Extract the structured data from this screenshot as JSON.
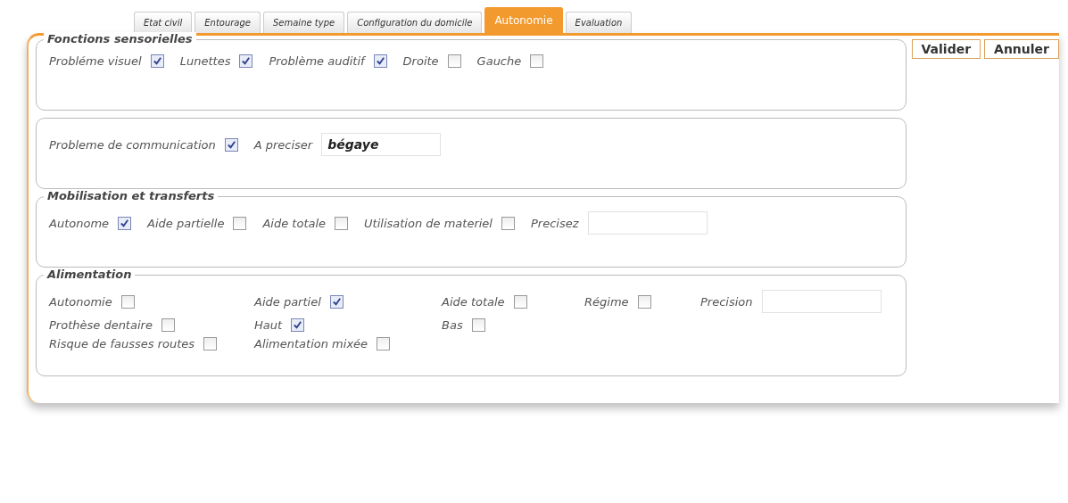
{
  "tabs": [
    {
      "label": "Etat civil",
      "selected": false
    },
    {
      "label": "Entourage",
      "selected": false
    },
    {
      "label": "Semaine type",
      "selected": false
    },
    {
      "label": "Configuration du domicile",
      "selected": false
    },
    {
      "label": "Autonomie",
      "selected": true
    },
    {
      "label": "Evaluation",
      "selected": false
    }
  ],
  "buttons": [
    "Valider",
    "Annuler"
  ],
  "sections": [
    {
      "legend": "Fonctions sensorielles",
      "rows": [
        [
          {
            "kind": "checkbox",
            "label": "Probléme visuel",
            "checked": true
          },
          {
            "kind": "checkbox",
            "label": "Lunettes",
            "checked": true
          },
          {
            "kind": "checkbox",
            "label": "Problème auditif",
            "checked": true
          },
          {
            "kind": "checkbox",
            "label": "Droite",
            "checked": false
          },
          {
            "kind": "checkbox",
            "label": "Gauche",
            "checked": false
          }
        ]
      ]
    },
    {
      "rows": [
        [
          {
            "kind": "checkbox",
            "label": "Probleme de communication",
            "checked": true
          },
          {
            "kind": "text",
            "label": "A preciser",
            "value": "bégaye"
          }
        ]
      ]
    },
    {
      "legend": "Mobilisation et transferts",
      "rows": [
        [
          {
            "kind": "checkbox",
            "label": "Autonome",
            "checked": true
          },
          {
            "kind": "checkbox",
            "label": "Aide partielle",
            "checked": false
          },
          {
            "kind": "checkbox",
            "label": "Aide totale",
            "checked": false
          },
          {
            "kind": "checkbox",
            "label": "Utilisation de materiel",
            "checked": false
          },
          {
            "kind": "text",
            "label": "Precisez"
          }
        ]
      ]
    },
    {
      "legend": "Alimentation",
      "grid": true,
      "rows": [
        [
          {
            "kind": "checkbox",
            "label": "Autonomie",
            "checked": false
          },
          {
            "kind": "checkbox",
            "label": "Aide partiel",
            "checked": true
          },
          {
            "kind": "checkbox",
            "label": "Aide totale",
            "checked": false
          },
          {
            "kind": "checkbox",
            "label": "Régime",
            "checked": false
          },
          {
            "kind": "text",
            "label": "Precision"
          }
        ],
        [
          {
            "kind": "checkbox",
            "label": "Prothèse dentaire",
            "checked": false
          },
          {
            "kind": "checkbox",
            "label": "Haut",
            "checked": true
          },
          {
            "kind": "checkbox",
            "label": "Bas",
            "checked": false
          }
        ],
        [
          {
            "kind": "checkbox",
            "label": "Risque de fausses routes",
            "checked": false
          },
          {
            "kind": "checkbox",
            "label": "Alimentation mixée",
            "checked": false
          }
        ]
      ]
    }
  ]
}
